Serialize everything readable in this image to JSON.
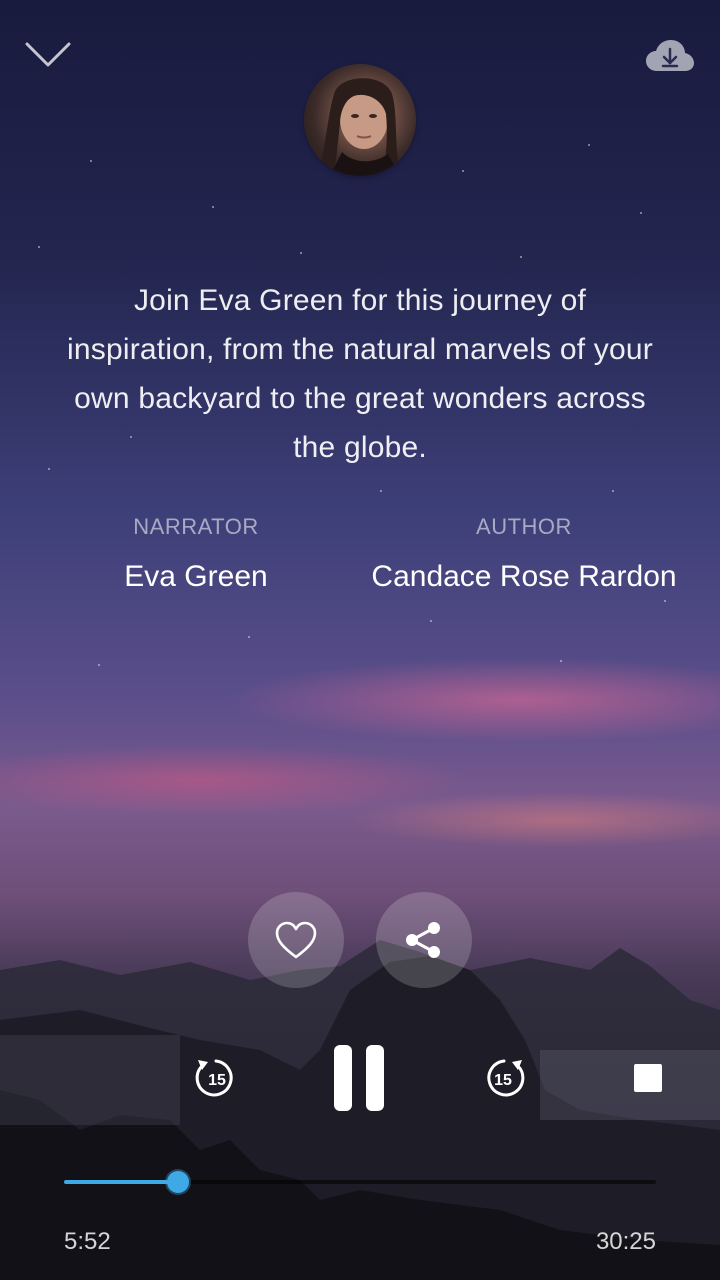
{
  "description": "Join Eva Green for this journey of inspiration, from the natural marvels of your own backyard to the great wonders across the globe.",
  "credits": {
    "narrator_label": "NARRATOR",
    "narrator_name": "Eva Green",
    "author_label": "AUTHOR",
    "author_name": "Candace Rose Rardon"
  },
  "controls": {
    "rewind_seconds": "15",
    "forward_seconds": "15"
  },
  "playback": {
    "elapsed": "5:52",
    "total": "30:25",
    "progress_fraction": 0.193
  },
  "colors": {
    "accent": "#3fa9e6"
  },
  "icons": {
    "collapse": "chevron-down-icon",
    "download": "cloud-download-icon",
    "like": "heart-icon",
    "share": "share-icon",
    "rewind": "rewind-15-icon",
    "pause": "pause-icon",
    "forward": "forward-15-icon",
    "stop": "stop-icon"
  }
}
